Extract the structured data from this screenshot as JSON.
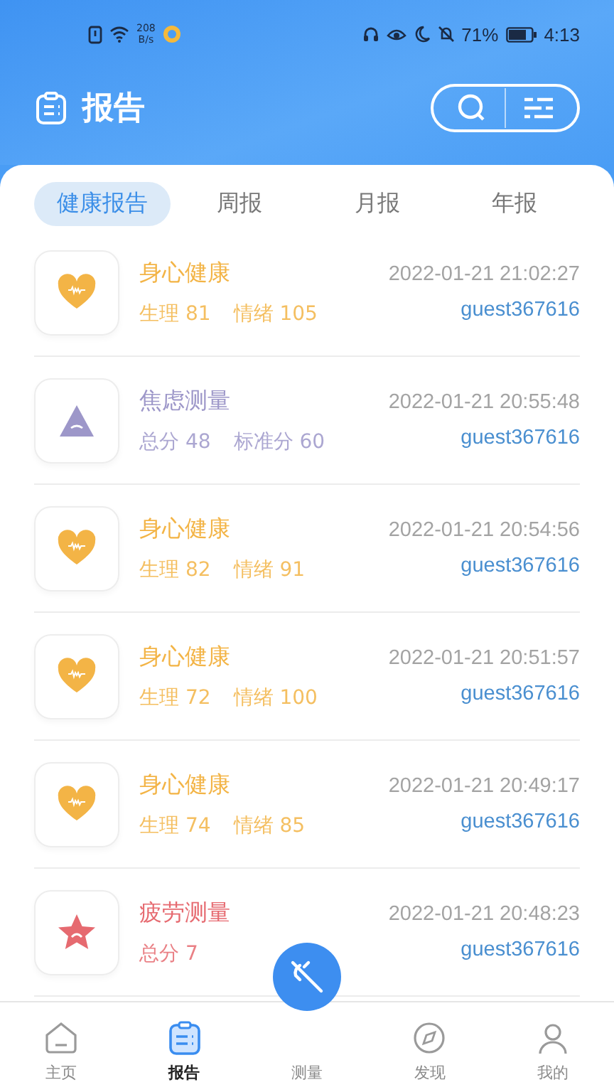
{
  "status_bar": {
    "net_speed": "208",
    "net_unit": "B/s",
    "battery": "71%",
    "time": "4:13"
  },
  "header": {
    "title": "报告"
  },
  "tabs": [
    {
      "label": "健康报告",
      "selected": true
    },
    {
      "label": "周报",
      "selected": false
    },
    {
      "label": "月报",
      "selected": false
    },
    {
      "label": "年报",
      "selected": false
    }
  ],
  "records": [
    {
      "kind": "health",
      "color": "#f3b446",
      "title": "身心健康",
      "stats": [
        "生理 81",
        "情绪 105"
      ],
      "time": "2022-01-21 21:02:27",
      "user": "guest367616"
    },
    {
      "kind": "anxiety",
      "color": "#9d97c9",
      "title": "焦虑测量",
      "stats": [
        "总分 48",
        "标准分 60"
      ],
      "time": "2022-01-21 20:55:48",
      "user": "guest367616"
    },
    {
      "kind": "health",
      "color": "#f3b446",
      "title": "身心健康",
      "stats": [
        "生理 82",
        "情绪 91"
      ],
      "time": "2022-01-21 20:54:56",
      "user": "guest367616"
    },
    {
      "kind": "health",
      "color": "#f3b446",
      "title": "身心健康",
      "stats": [
        "生理 72",
        "情绪 100"
      ],
      "time": "2022-01-21 20:51:57",
      "user": "guest367616"
    },
    {
      "kind": "health",
      "color": "#f3b446",
      "title": "身心健康",
      "stats": [
        "生理 74",
        "情绪 85"
      ],
      "time": "2022-01-21 20:49:17",
      "user": "guest367616"
    },
    {
      "kind": "fatigue",
      "color": "#e66a70",
      "title": "疲劳测量",
      "stats": [
        "总分 7"
      ],
      "time": "2022-01-21 20:48:23",
      "user": "guest367616"
    }
  ],
  "nav": [
    {
      "kind": "home",
      "label": "主页",
      "selected": false
    },
    {
      "kind": "report",
      "label": "报告",
      "selected": true
    },
    {
      "kind": "measure",
      "label": "测量",
      "selected": false
    },
    {
      "kind": "discover",
      "label": "发现",
      "selected": false
    },
    {
      "kind": "me",
      "label": "我的",
      "selected": false
    }
  ]
}
